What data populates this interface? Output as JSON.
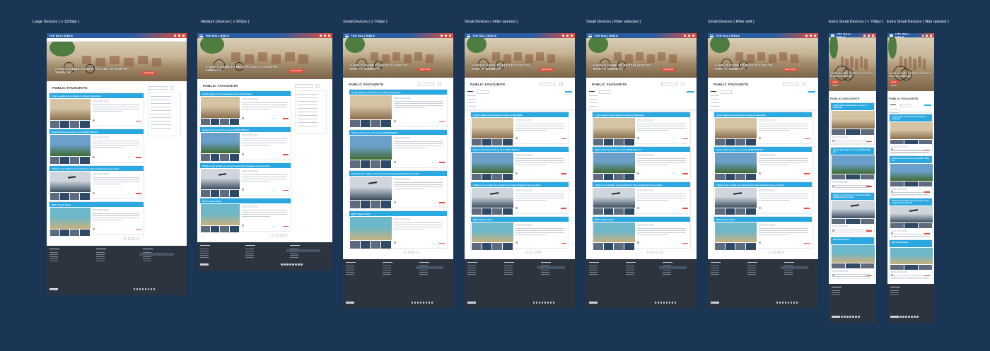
{
  "labels": [
    "Large Devices ( ≥ 1200px )",
    "Medium Devices ( ≥ 992px )",
    "Small Devices ( ≥ 768px )",
    "Small Devices ( Filter opened )",
    "Small Devices ( Filter selected )",
    "Small Devices ( Filter edit )",
    "Extra Small Devices ( < 768px )",
    "Extra Small Devices ( filter opened )"
  ],
  "brand": "THE BALI BIBLE",
  "hero_caption": "A GIRL'S GUIDE TO BEST PLACES TO SHOP IN SEMINYAK",
  "hero_button": "READ MORE",
  "section_title": "PUBLIC FAVOURITE",
  "cards": [
    {
      "title": "A girl's guide to best places to shop in Seminyak"
    },
    {
      "title": "Venues that need to be on your MUST SEE list"
    },
    {
      "title": "Things to do in Bali, you would never have imagined were possible"
    },
    {
      "title": "BEST Beach Clubs"
    }
  ],
  "colors": {
    "background": "#1b3655",
    "header": "#2a5d9f",
    "accent": "#e74c3c",
    "card_title": "#2ba8e0",
    "footer": "#2c3440"
  }
}
